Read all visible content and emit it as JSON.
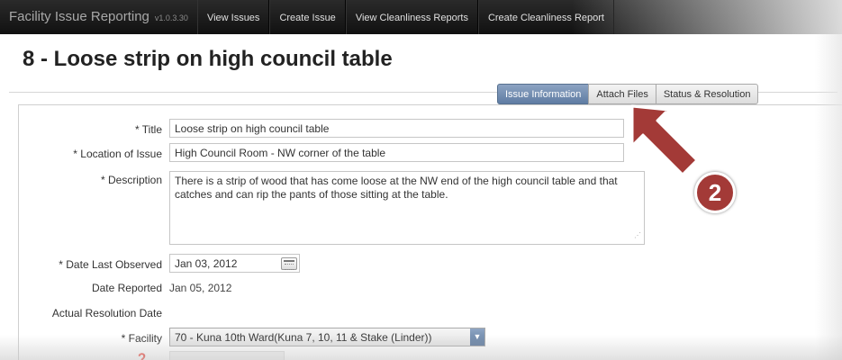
{
  "app": {
    "title": "Facility Issue Reporting",
    "version": "v1.0.3.30"
  },
  "nav": {
    "items": [
      {
        "label": "View Issues"
      },
      {
        "label": "Create Issue"
      },
      {
        "label": "View Cleanliness Reports"
      },
      {
        "label": "Create Cleanliness Report"
      }
    ]
  },
  "page": {
    "title": "8 - Loose strip on high council table"
  },
  "tabs": [
    {
      "label": "Issue Information",
      "active": true
    },
    {
      "label": "Attach Files",
      "active": false
    },
    {
      "label": "Status & Resolution",
      "active": false
    }
  ],
  "form": {
    "title_label": "* Title",
    "title_value": "Loose strip on high council table",
    "location_label": "* Location of Issue",
    "location_value": "High Council Room - NW corner of the table",
    "description_label": "* Description",
    "description_value": "There is a strip of wood that has come loose at the NW end of the high council table and that catches and can rip the pants of those sitting at the table.",
    "date_observed_label": "* Date Last Observed",
    "date_observed_value": "Jan 03, 2012",
    "date_reported_label": "Date Reported",
    "date_reported_value": "Jan 05, 2012",
    "actual_resolution_label": "Actual Resolution Date",
    "facility_label": "* Facility",
    "facility_value": "70 - Kuna 10th Ward(Kuna 7, 10, 11 & Stake (Linder))"
  },
  "annotation": {
    "step_number": "2",
    "color": "#a33a37"
  },
  "icons": {
    "calendar": "calendar-icon",
    "dropdown": "chevron-down-icon",
    "arrow": "arrow-icon"
  }
}
